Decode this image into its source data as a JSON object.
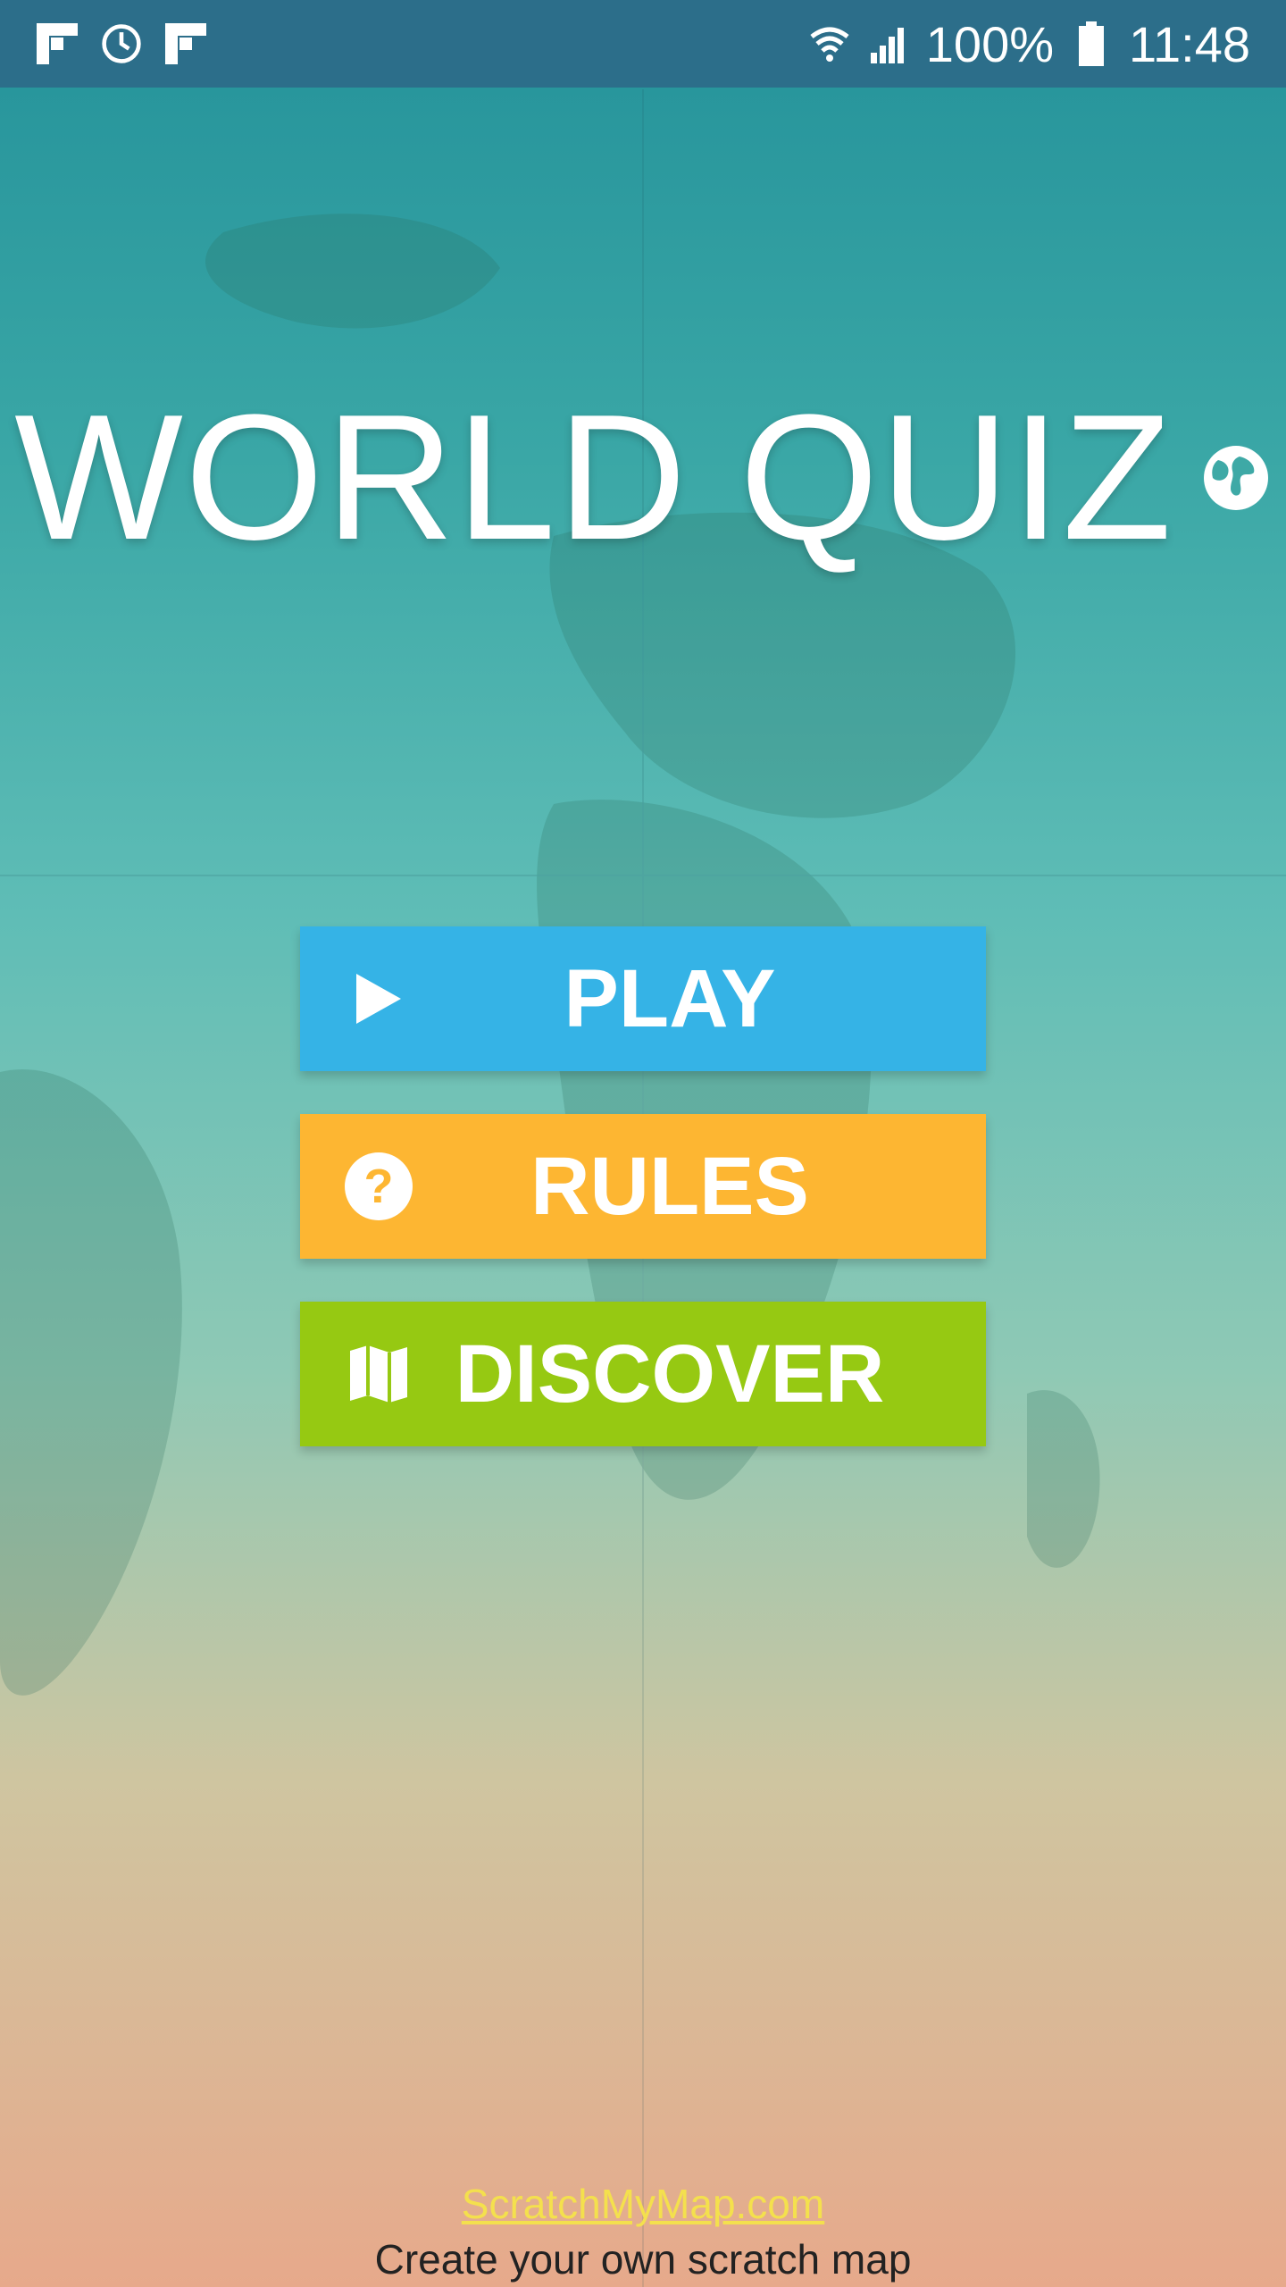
{
  "statusbar": {
    "battery": "100%",
    "time": "11:48"
  },
  "title": "WORLD QUIZ",
  "buttons": {
    "play": "PLAY",
    "rules": "RULES",
    "discover": "DISCOVER"
  },
  "footer": {
    "link": "ScratchMyMap.com",
    "tagline": "Create your own scratch map"
  },
  "colors": {
    "play": "#35b3e6",
    "rules": "#fdb632",
    "discover": "#96c912",
    "statusbar": "#2c6e8a",
    "link": "#f4e04d"
  }
}
